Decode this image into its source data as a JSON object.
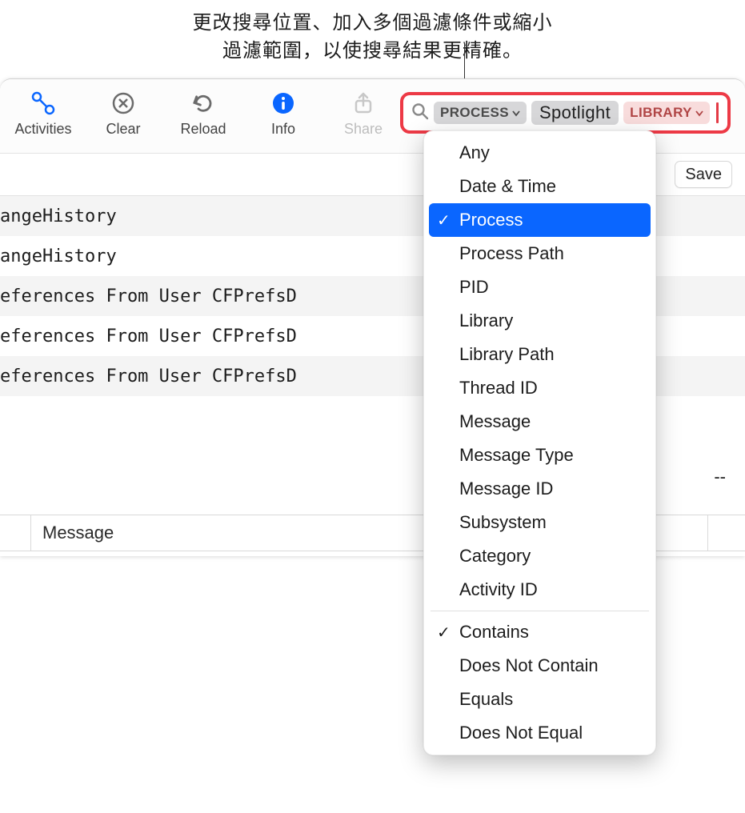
{
  "callout": {
    "line1": "更改搜尋位置、加入多個過濾條件或縮小",
    "line2": "過濾範圍，以使搜尋結果更精確。"
  },
  "toolbar": {
    "activities": "Activities",
    "clear": "Clear",
    "reload": "Reload",
    "info": "Info",
    "share": "Share"
  },
  "search": {
    "token_field_label": "PROCESS",
    "token_value": "Spotlight",
    "token_field2_label": "LIBRARY"
  },
  "save_label": "Save",
  "log_rows": [
    "angeHistory",
    "angeHistory",
    "eferences From User CFPrefsD",
    "eferences From User CFPrefsD",
    "eferences From User CFPrefsD"
  ],
  "placeholder_value": "--",
  "message_header": "Message",
  "filter_menu": {
    "fields": [
      {
        "label": "Any",
        "selected": false,
        "checked": false
      },
      {
        "label": "Date & Time",
        "selected": false,
        "checked": false
      },
      {
        "label": "Process",
        "selected": true,
        "checked": true
      },
      {
        "label": "Process Path",
        "selected": false,
        "checked": false
      },
      {
        "label": "PID",
        "selected": false,
        "checked": false
      },
      {
        "label": "Library",
        "selected": false,
        "checked": false
      },
      {
        "label": "Library Path",
        "selected": false,
        "checked": false
      },
      {
        "label": "Thread ID",
        "selected": false,
        "checked": false
      },
      {
        "label": "Message",
        "selected": false,
        "checked": false
      },
      {
        "label": "Message Type",
        "selected": false,
        "checked": false
      },
      {
        "label": "Message ID",
        "selected": false,
        "checked": false
      },
      {
        "label": "Subsystem",
        "selected": false,
        "checked": false
      },
      {
        "label": "Category",
        "selected": false,
        "checked": false
      },
      {
        "label": "Activity ID",
        "selected": false,
        "checked": false
      }
    ],
    "operators": [
      {
        "label": "Contains",
        "checked": true
      },
      {
        "label": "Does Not Contain",
        "checked": false
      },
      {
        "label": "Equals",
        "checked": false
      },
      {
        "label": "Does Not Equal",
        "checked": false
      }
    ]
  }
}
